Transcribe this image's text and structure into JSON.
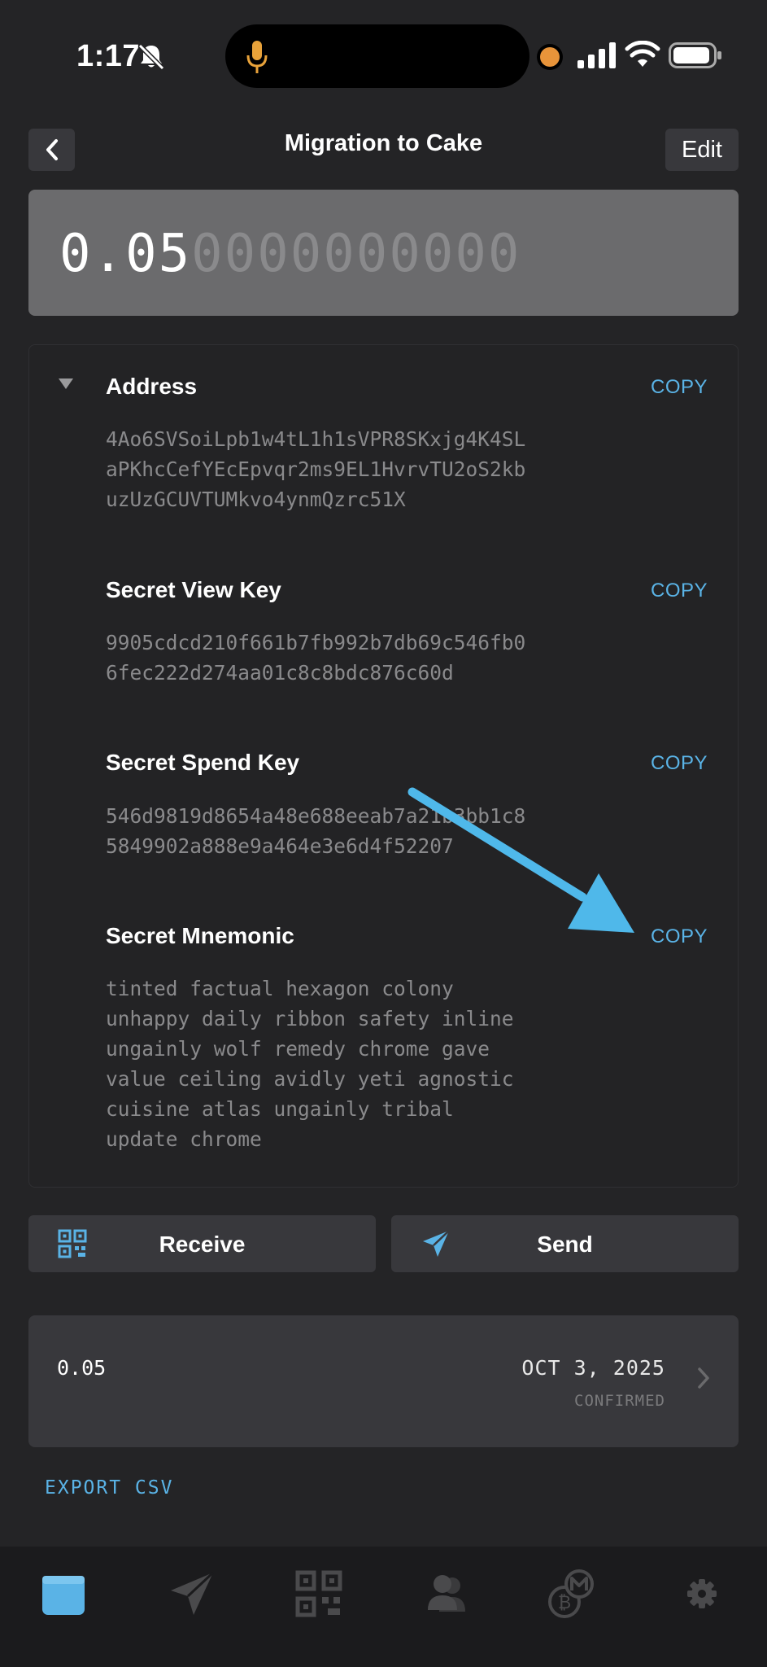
{
  "status_bar": {
    "time": "1:17"
  },
  "header": {
    "title": "Migration to Cake",
    "edit_label": "Edit"
  },
  "balance": {
    "main": "0.05",
    "trailing": "0000000000"
  },
  "keys": [
    {
      "label": "Address",
      "copy": "COPY",
      "value": "4Ao6SVSoiLpb1w4tL1h1sVPR8SKxjg4K4SL\naPKhcCefYEcEpvqr2ms9EL1HvrvTU2oS2kb\nuzUzGCUVTUMkvo4ynmQzrc51X"
    },
    {
      "label": "Secret View Key",
      "copy": "COPY",
      "value": "9905cdcd210f661b7fb992b7db69c546fb0\n6fec222d274aa01c8c8bdc876c60d"
    },
    {
      "label": "Secret Spend Key",
      "copy": "COPY",
      "value": "546d9819d8654a48e688eeab7a21b3bb1c8\n5849902a888e9a464e3e6d4f52207"
    },
    {
      "label": "Secret Mnemonic",
      "copy": "COPY",
      "value": "tinted factual hexagon colony\nunhappy daily ribbon safety inline\nungainly wolf remedy chrome gave\nvalue ceiling avidly yeti agnostic\ncuisine atlas ungainly tribal\nupdate chrome"
    }
  ],
  "actions": {
    "receive": "Receive",
    "send": "Send"
  },
  "transaction": {
    "amount": "0.05",
    "date": "OCT 3, 2025",
    "status": "CONFIRMED"
  },
  "export_label": "EXPORT CSV",
  "colors": {
    "accent": "#5ab3e6",
    "background": "#242426",
    "card": "#38383c",
    "arrow": "#4fb8ea"
  },
  "tabs": [
    {
      "name": "wallet-tab",
      "icon": "wallet-icon",
      "active": true
    },
    {
      "name": "send-tab",
      "icon": "paper-plane-icon"
    },
    {
      "name": "qr-tab",
      "icon": "qr-code-icon"
    },
    {
      "name": "contacts-tab",
      "icon": "contacts-icon"
    },
    {
      "name": "crypto-tab",
      "icon": "coins-icon"
    },
    {
      "name": "settings-tab",
      "icon": "gear-icon"
    }
  ]
}
